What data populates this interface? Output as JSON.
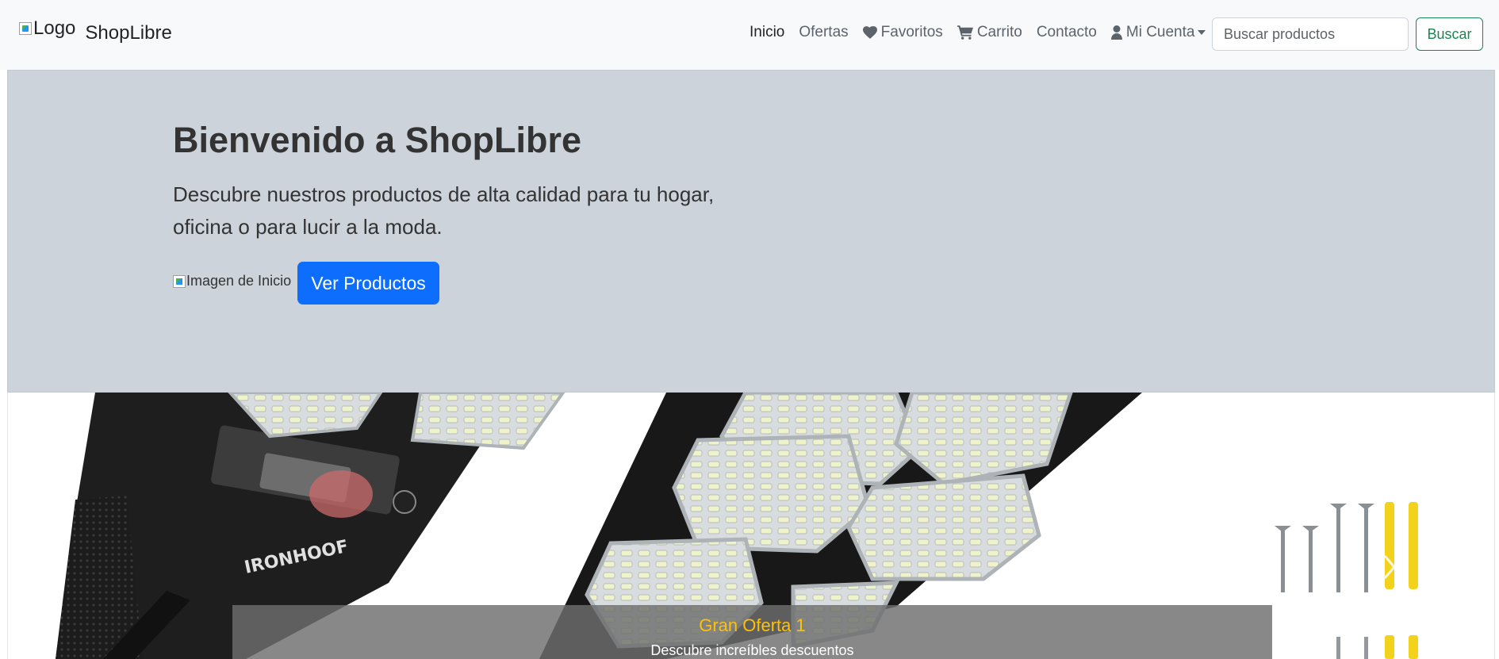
{
  "navbar": {
    "logo_alt": "Logo",
    "brand": "ShopLibre",
    "links": [
      {
        "label": "Inicio",
        "icon": "",
        "active": true
      },
      {
        "label": "Ofertas",
        "icon": ""
      },
      {
        "label": "Favoritos",
        "icon": "heart-icon"
      },
      {
        "label": "Carrito",
        "icon": "cart-icon"
      },
      {
        "label": "Contacto",
        "icon": ""
      },
      {
        "label": "Mi Cuenta",
        "icon": "user-icon",
        "dropdown": true
      }
    ],
    "search": {
      "placeholder": "Buscar productos",
      "value": ""
    },
    "search_button": "Buscar"
  },
  "hero": {
    "title": "Bienvenido a ShopLibre",
    "lead": "Descubre nuestros productos de alta calidad para tu hogar, oficina o para lucir a la moda.",
    "image_alt": "Imagen de Inicio",
    "button": "Ver Productos"
  },
  "carousel": {
    "slides": [
      {
        "caption_title": "Gran Oferta 1",
        "caption_text": "Descubre increíbles descuentos"
      }
    ]
  },
  "colors": {
    "navbar_bg": "#f8f9fa",
    "hero_bg": "#cdd3da",
    "primary": "#0d6efd",
    "success": "#198754",
    "caption_title": "#ffc107"
  }
}
